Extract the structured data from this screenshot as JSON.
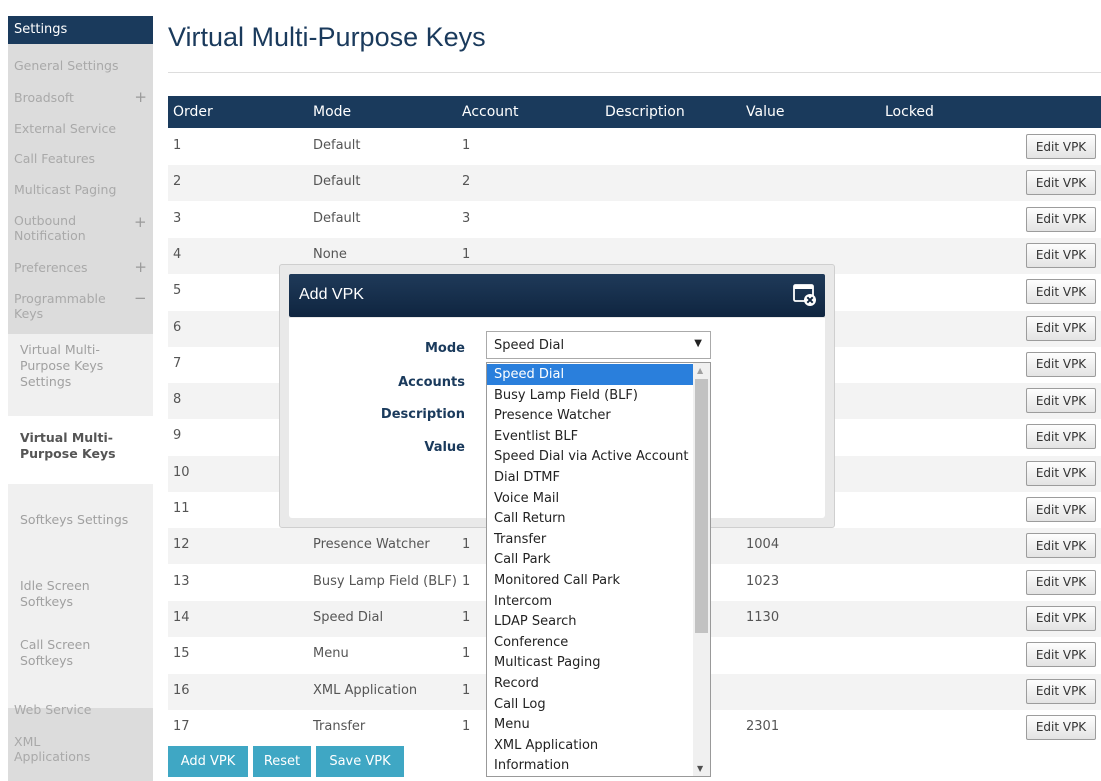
{
  "sidebar": {
    "title": "Settings",
    "items": {
      "general": "General Settings",
      "broadsoft": "Broadsoft",
      "external": "External Service",
      "callfeatures": "Call Features",
      "multicast": "Multicast Paging",
      "outbound": "Outbound Notification",
      "preferences": "Preferences",
      "programmable": "Programmable Keys",
      "webservice": "Web Service",
      "xmlapps": "XML Applications"
    },
    "sub": {
      "vmpk_settings": "Virtual Multi-Purpose Keys Settings",
      "vmpk": "Virtual Multi-Purpose Keys",
      "softkeys": "Softkeys Settings",
      "idle": "Idle Screen Softkeys",
      "call": "Call Screen Softkeys"
    },
    "plus_icon": "+",
    "minus_icon": "−"
  },
  "page": {
    "title": "Virtual Multi-Purpose Keys"
  },
  "table": {
    "headers": {
      "order": "Order",
      "mode": "Mode",
      "account": "Account",
      "description": "Description",
      "value": "Value",
      "locked": "Locked"
    },
    "edit_label": "Edit VPK",
    "rows": [
      {
        "order": "1",
        "mode": "Default",
        "account": "1",
        "value": ""
      },
      {
        "order": "2",
        "mode": "Default",
        "account": "2",
        "value": ""
      },
      {
        "order": "3",
        "mode": "Default",
        "account": "3",
        "value": ""
      },
      {
        "order": "4",
        "mode": "None",
        "account": "1",
        "value": ""
      },
      {
        "order": "5",
        "mode": "",
        "account": "",
        "value": ""
      },
      {
        "order": "6",
        "mode": "",
        "account": "",
        "value": ""
      },
      {
        "order": "7",
        "mode": "",
        "account": "",
        "value": ""
      },
      {
        "order": "8",
        "mode": "",
        "account": "",
        "value": ""
      },
      {
        "order": "9",
        "mode": "",
        "account": "",
        "value": ""
      },
      {
        "order": "10",
        "mode": "",
        "account": "",
        "value": ""
      },
      {
        "order": "11",
        "mode": "",
        "account": "",
        "value": ""
      },
      {
        "order": "12",
        "mode": "Presence Watcher",
        "account": "1",
        "value": "1004"
      },
      {
        "order": "13",
        "mode": "Busy Lamp Field (BLF)",
        "account": "1",
        "value": "1023"
      },
      {
        "order": "14",
        "mode": "Speed Dial",
        "account": "1",
        "value": "1130"
      },
      {
        "order": "15",
        "mode": "Menu",
        "account": "1",
        "value": ""
      },
      {
        "order": "16",
        "mode": "XML Application",
        "account": "1",
        "value": ""
      },
      {
        "order": "17",
        "mode": "Transfer",
        "account": "1",
        "value": "2301"
      }
    ]
  },
  "buttons": {
    "add": "Add VPK",
    "reset": "Reset",
    "save": "Save VPK"
  },
  "modal": {
    "title": "Add VPK",
    "labels": {
      "mode": "Mode",
      "accounts": "Accounts",
      "description": "Description",
      "value": "Value"
    },
    "mode_selected": "Speed Dial",
    "mode_options": [
      "Speed Dial",
      "Busy Lamp Field (BLF)",
      "Presence Watcher",
      "Eventlist BLF",
      "Speed Dial via Active Account",
      "Dial DTMF",
      "Voice Mail",
      "Call Return",
      "Transfer",
      "Call Park",
      "Monitored Call Park",
      "Intercom",
      "LDAP Search",
      "Conference",
      "Multicast Paging",
      "Record",
      "Call Log",
      "Menu",
      "XML Application",
      "Information"
    ]
  },
  "colors": {
    "navy": "#1a3a5c",
    "accent": "#3fa7c4",
    "selected": "#2a7fdc"
  },
  "icons": {
    "close": "window-close-icon",
    "select_arrow": "▼"
  }
}
